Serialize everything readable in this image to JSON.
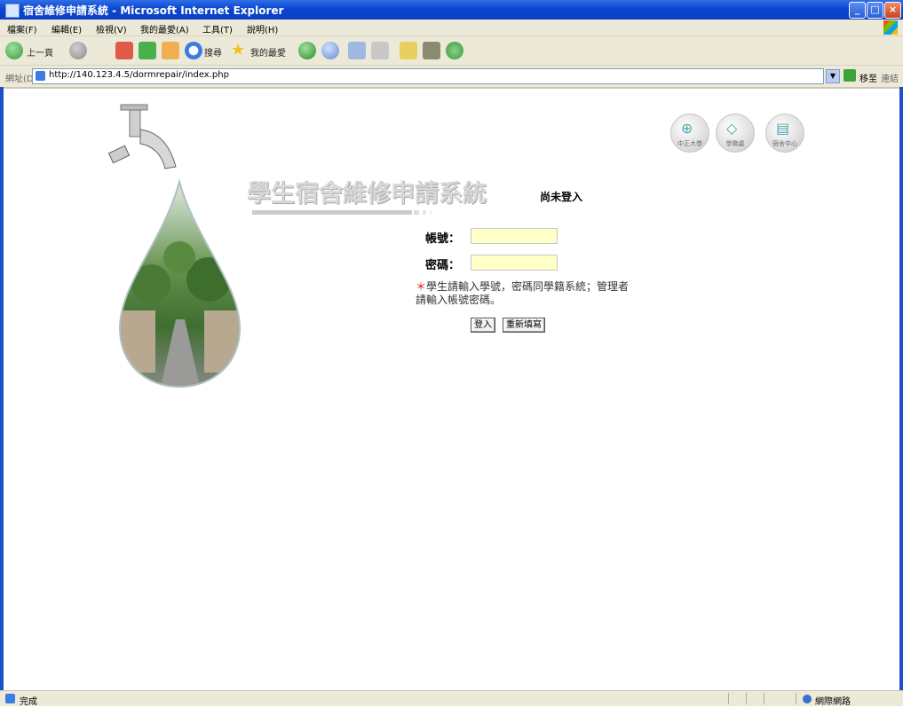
{
  "window": {
    "title": "宿舍維修申請系統 - Microsoft Internet Explorer"
  },
  "menu": [
    "檔案(F)",
    "編輯(E)",
    "檢視(V)",
    "我的最愛(A)",
    "工具(T)",
    "說明(H)"
  ],
  "toolbar": {
    "back_label": "上一頁",
    "search_label": "搜尋",
    "favorites_label": "我的最愛"
  },
  "address": {
    "label": "網址(D)",
    "url": "http://140.123.4.5/dormrepair/index.php",
    "go_label": "移至",
    "links_label": "連結"
  },
  "page": {
    "site_title": "學生宿舍維修申請系統",
    "login_status": "尚未登入",
    "icons": [
      {
        "name": "中正大學",
        "glyph": "⊕"
      },
      {
        "name": "學務處",
        "glyph": "◇"
      },
      {
        "name": "宿舍中心",
        "glyph": "▤"
      }
    ],
    "account_label": "帳號：",
    "account_value": "",
    "password_label": "密碼：",
    "password_value": "",
    "hint_star": "＊",
    "hint": "學生請輸入學號，密碼同學籍系統；管理者請輸入帳號密碼。",
    "login_button": "登入",
    "reset_button": "重新填寫"
  },
  "status": {
    "text": "完成",
    "zone": "網際網路"
  },
  "colors": {
    "titlebar": "#0a46d0",
    "chrome": "#ece9d8",
    "input_bg": "#ffffc8",
    "hint_star": "#d01818"
  }
}
